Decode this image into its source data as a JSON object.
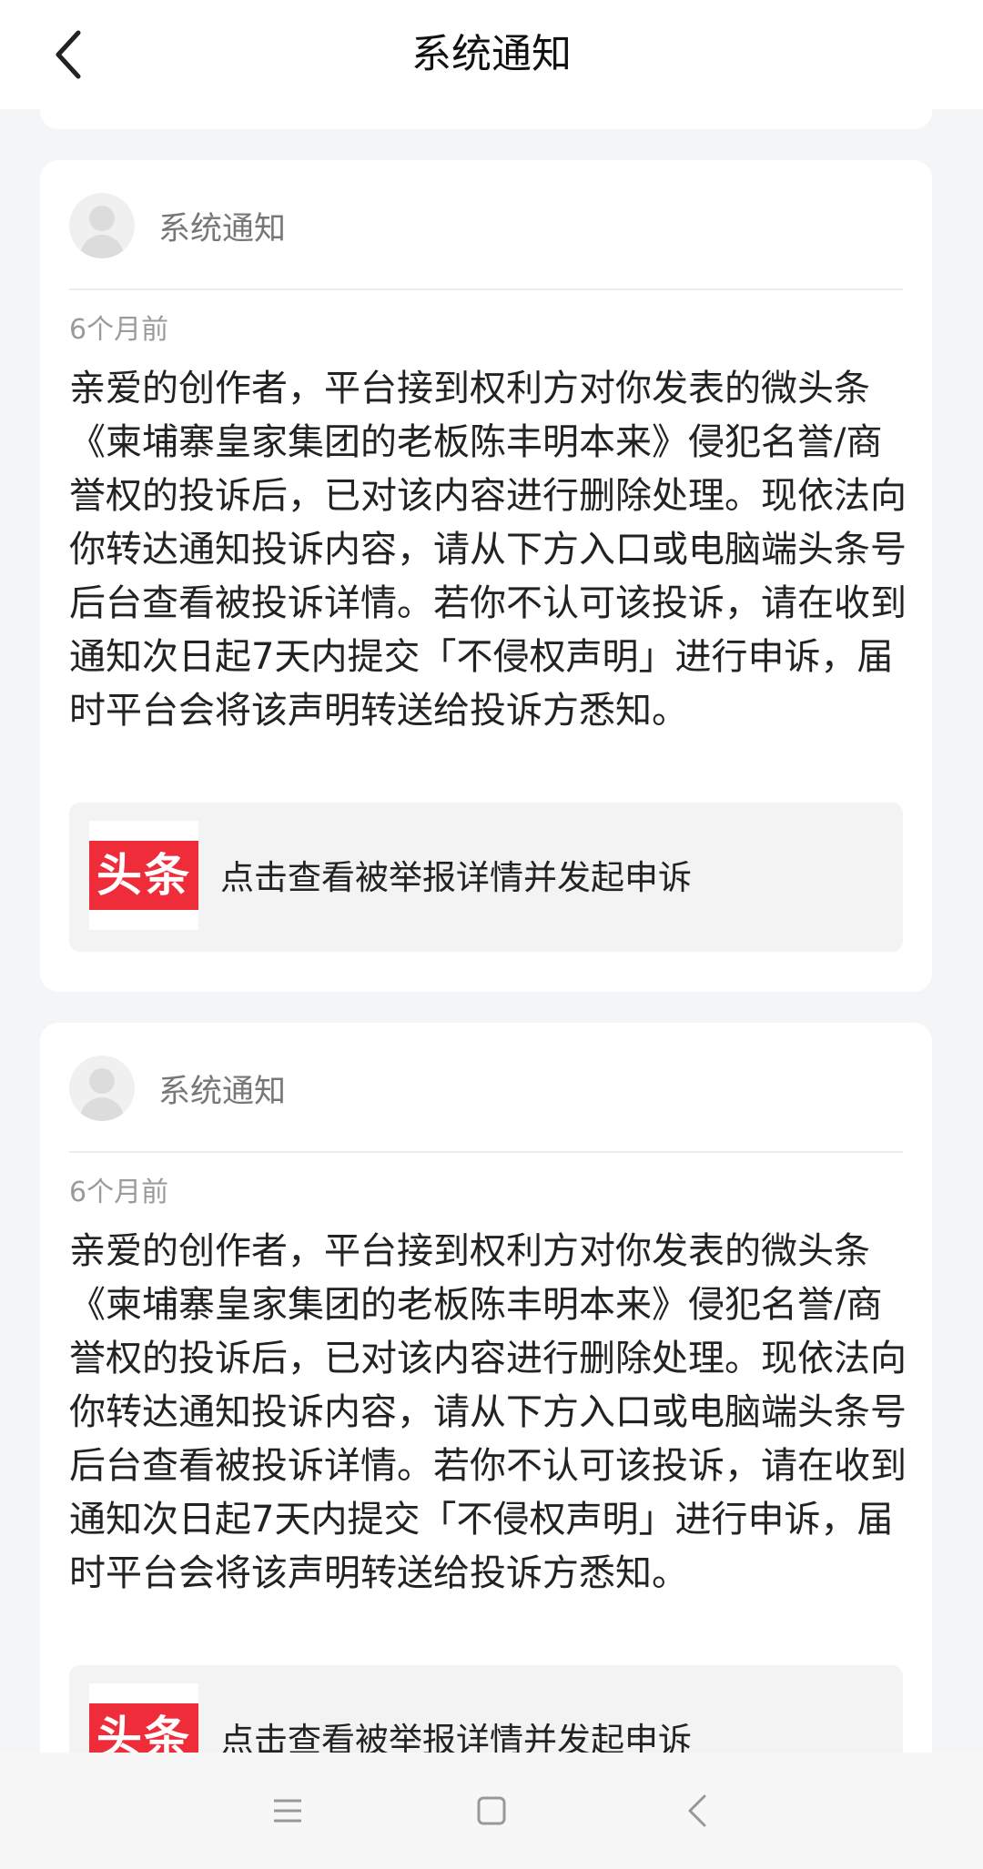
{
  "header": {
    "title": "系统通知"
  },
  "notifications": [
    {
      "sender": "系统通知",
      "time": "6个月前",
      "body": "亲爱的创作者，平台接到权利方对你发表的微头条《柬埔寨皇家集团的老板陈丰明本来》侵犯名誉/商誉权的投诉后，已对该内容进行删除处理。现依法向你转达通知投诉内容，请从下方入口或电脑端头条号后台查看被投诉详情。若你不认可该投诉，请在收到通知次日起7天内提交「不侵权声明」进行申诉，届时平台会将该声明转送给投诉方悉知。",
      "link_text": "点击查看被举报详情并发起申诉",
      "logo_text": "头条"
    },
    {
      "sender": "系统通知",
      "time": "6个月前",
      "body": "亲爱的创作者，平台接到权利方对你发表的微头条《柬埔寨皇家集团的老板陈丰明本来》侵犯名誉/商誉权的投诉后，已对该内容进行删除处理。现依法向你转达通知投诉内容，请从下方入口或电脑端头条号后台查看被投诉详情。若你不认可该投诉，请在收到通知次日起7天内提交「不侵权声明」进行申诉，届时平台会将该声明转送给投诉方悉知。",
      "link_text": "点击查看被举报详情并发起申诉",
      "logo_text": "头条"
    }
  ],
  "colors": {
    "brand_red": "#ee2c3a",
    "page_bg": "#f4f5f6"
  },
  "icons": {
    "back": "chevron-left-icon",
    "nav_menu": "menu-icon",
    "nav_home": "home-square-icon",
    "nav_back": "back-triangle-icon"
  }
}
